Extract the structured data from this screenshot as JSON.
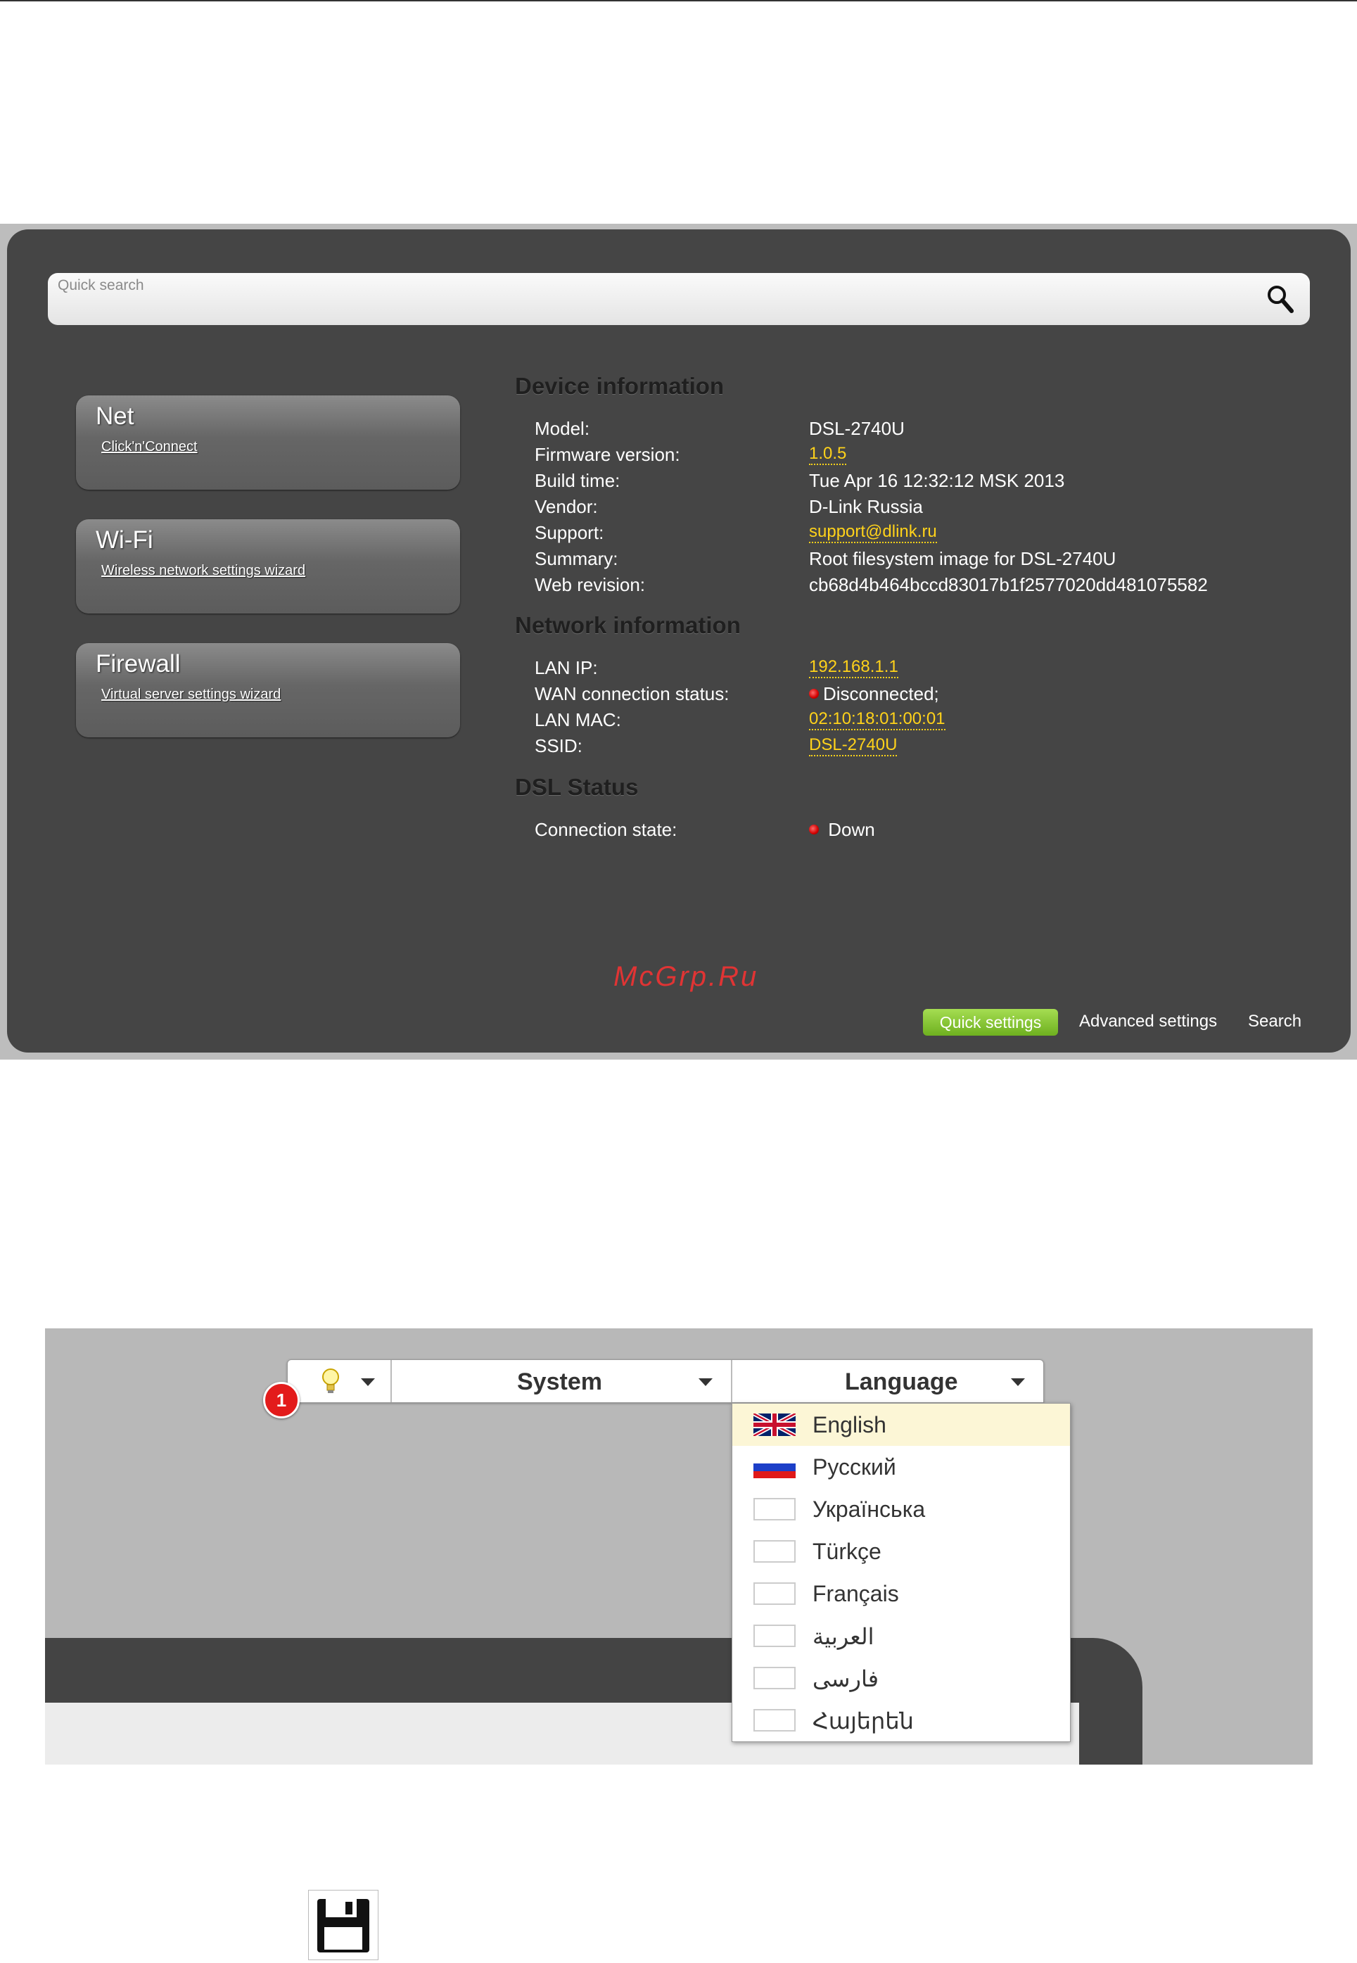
{
  "quick_search": {
    "placeholder": "Quick search",
    "icon": "search-icon"
  },
  "cards": [
    {
      "title": "Net",
      "link": "Click'n'Connect"
    },
    {
      "title": "Wi-Fi",
      "link": "Wireless network settings wizard"
    },
    {
      "title": "Firewall",
      "link": "Virtual server settings wizard"
    }
  ],
  "device_info": {
    "title": "Device information",
    "rows": [
      {
        "label": "Model:",
        "value": "DSL-2740U"
      },
      {
        "label": "Firmware version:",
        "value": "1.0.5"
      },
      {
        "label": "Build time:",
        "value": "Tue Apr 16 12:32:12 MSK 2013"
      },
      {
        "label": "Vendor:",
        "value": "D-Link Russia"
      },
      {
        "label": "Support:",
        "value": "support@dlink.ru"
      },
      {
        "label": "Summary:",
        "value": "Root filesystem image for DSL-2740U"
      },
      {
        "label": "Web revision:",
        "value": "cb68d4b464bccd83017b1f2577020dd481075582"
      }
    ]
  },
  "network_info": {
    "title": "Network information",
    "rows": [
      {
        "label": "LAN IP:",
        "value": "192.168.1.1"
      },
      {
        "label": "WAN connection status:",
        "value": "Disconnected;"
      },
      {
        "label": "LAN MAC:",
        "value": "02:10:18:01:00:01"
      },
      {
        "label": "SSID:",
        "value": "DSL-2740U"
      }
    ]
  },
  "dsl_status": {
    "title": "DSL Status",
    "rows": [
      {
        "label": "Connection state:",
        "value": "Down"
      }
    ]
  },
  "watermark": "McGrp.Ru",
  "footer": {
    "quick": "Quick settings",
    "advanced": "Advanced settings",
    "search": "Search"
  },
  "menubar": {
    "hint_icon": "lightbulb-icon",
    "system": "System",
    "language": "Language",
    "badge": "1"
  },
  "languages": [
    {
      "name": "English",
      "flag": "uk",
      "selected": true
    },
    {
      "name": "Русский",
      "flag": "ru"
    },
    {
      "name": "Українська",
      "flag": "blank"
    },
    {
      "name": "Türkçe",
      "flag": "blank"
    },
    {
      "name": "Français",
      "flag": "blank"
    },
    {
      "name": "العربية",
      "flag": "blank"
    },
    {
      "name": "فارسی",
      "flag": "blank"
    },
    {
      "name": "Հայերեն",
      "flag": "blank"
    }
  ],
  "colors": {
    "link": "#ffd21a",
    "accent_green": "#7cc12b",
    "badge": "#e31b1b",
    "panel": "#454545"
  },
  "save_icon": "save-icon"
}
